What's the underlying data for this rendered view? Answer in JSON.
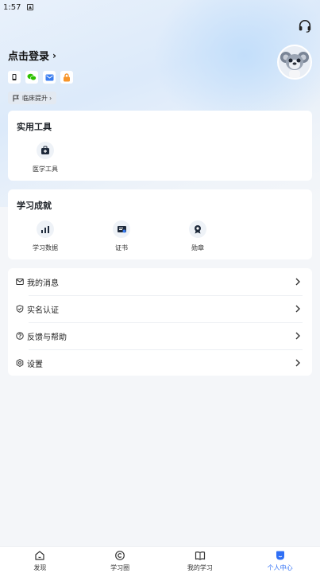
{
  "status_bar": {
    "time": "1:57"
  },
  "profile": {
    "login_label": "点击登录",
    "bind_icons": [
      "phone-icon",
      "wechat-icon",
      "mail-icon",
      "lock-icon"
    ],
    "tag_label": "临床提升"
  },
  "tools_card": {
    "title": "实用工具",
    "items": [
      {
        "label": "医学工具",
        "icon": "medical-kit-icon"
      }
    ]
  },
  "achievements_card": {
    "title": "学习成就",
    "items": [
      {
        "label": "学习数据",
        "icon": "bar-chart-icon"
      },
      {
        "label": "证书",
        "icon": "certificate-icon"
      },
      {
        "label": "勋章",
        "icon": "medal-icon"
      }
    ]
  },
  "menu": [
    {
      "label": "我的消息",
      "icon": "message-icon"
    },
    {
      "label": "实名认证",
      "icon": "shield-check-icon"
    },
    {
      "label": "反馈与帮助",
      "icon": "help-icon"
    },
    {
      "label": "设置",
      "icon": "settings-icon"
    }
  ],
  "tabbar": {
    "tabs": [
      {
        "label": "发现",
        "icon": "home-icon",
        "active": false
      },
      {
        "label": "学习圈",
        "icon": "circle-icon",
        "active": false
      },
      {
        "label": "我的学习",
        "icon": "book-icon",
        "active": false
      },
      {
        "label": "个人中心",
        "icon": "profile-icon",
        "active": true
      }
    ]
  },
  "colors": {
    "accent": "#2f6ff5",
    "background": "#f4f6f9"
  }
}
